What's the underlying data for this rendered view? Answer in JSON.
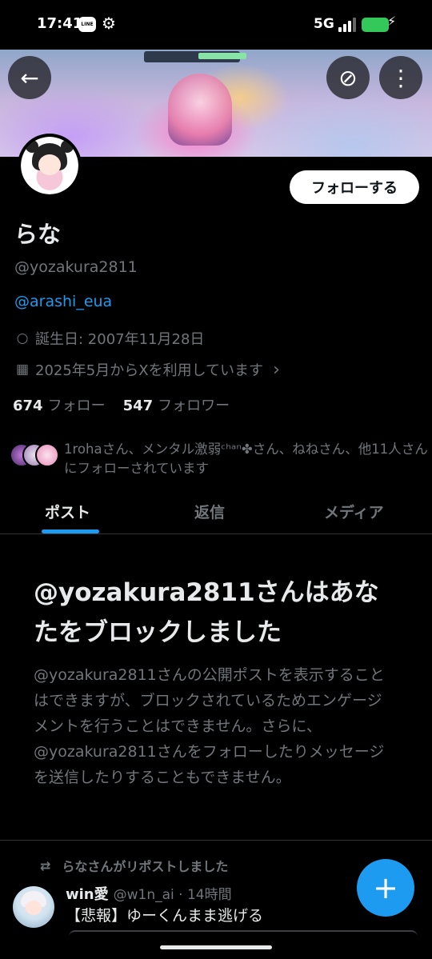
{
  "status_bar": {
    "time": "17:41",
    "line_badge": "LINE",
    "network": "5G",
    "icons": [
      "line-app-icon",
      "gear-icon",
      "signal-icon",
      "battery-icon",
      "charging-bolt-icon"
    ]
  },
  "header": {
    "back_icon": "←",
    "disconnect_icon": "⊘",
    "more_icon": "⋮"
  },
  "profile": {
    "follow_button": "フォローする",
    "display_name": "らな",
    "handle": "@yozakura2811",
    "bio_link": "@arashi_eua",
    "birthday": "誕生日: 2007年11月28日",
    "joined": "2025年5月からXを利用しています",
    "joined_chevron": "›",
    "following_count": "674",
    "following_label": "フォロー",
    "followers_count": "547",
    "followers_label": "フォロワー",
    "followed_by": "1rohaさん、メンタル激弱ᶜʰᵃⁿ✤さん、ねねさん、他11人さんにフォローされています"
  },
  "tabs": [
    {
      "label": "ポスト",
      "active": true
    },
    {
      "label": "返信",
      "active": false
    },
    {
      "label": "メディア",
      "active": false
    }
  ],
  "blocked": {
    "title": "@yozakura2811さんはあなたをブロックしました",
    "body": "@yozakura2811さんの公開ポストを表示することはできますが、ブロックされているためエンゲージメントを行うことはできません。さらに、@yozakura2811さんをフォローしたりメッセージを送信したりすることもできません。"
  },
  "timeline": {
    "repost_label": "らなさんがリポストしました",
    "tweet_name": "win愛",
    "tweet_handle_time": "@w1n_ai · 14時間",
    "tweet_text": "【悲報】ゆーくんまま逃げる"
  },
  "fab_label": "+",
  "colors": {
    "accent": "#1d9bf0",
    "background": "#000000",
    "secondary_text": "#71767b",
    "primary_text": "#e7e9ea",
    "battery": "#34c759"
  }
}
